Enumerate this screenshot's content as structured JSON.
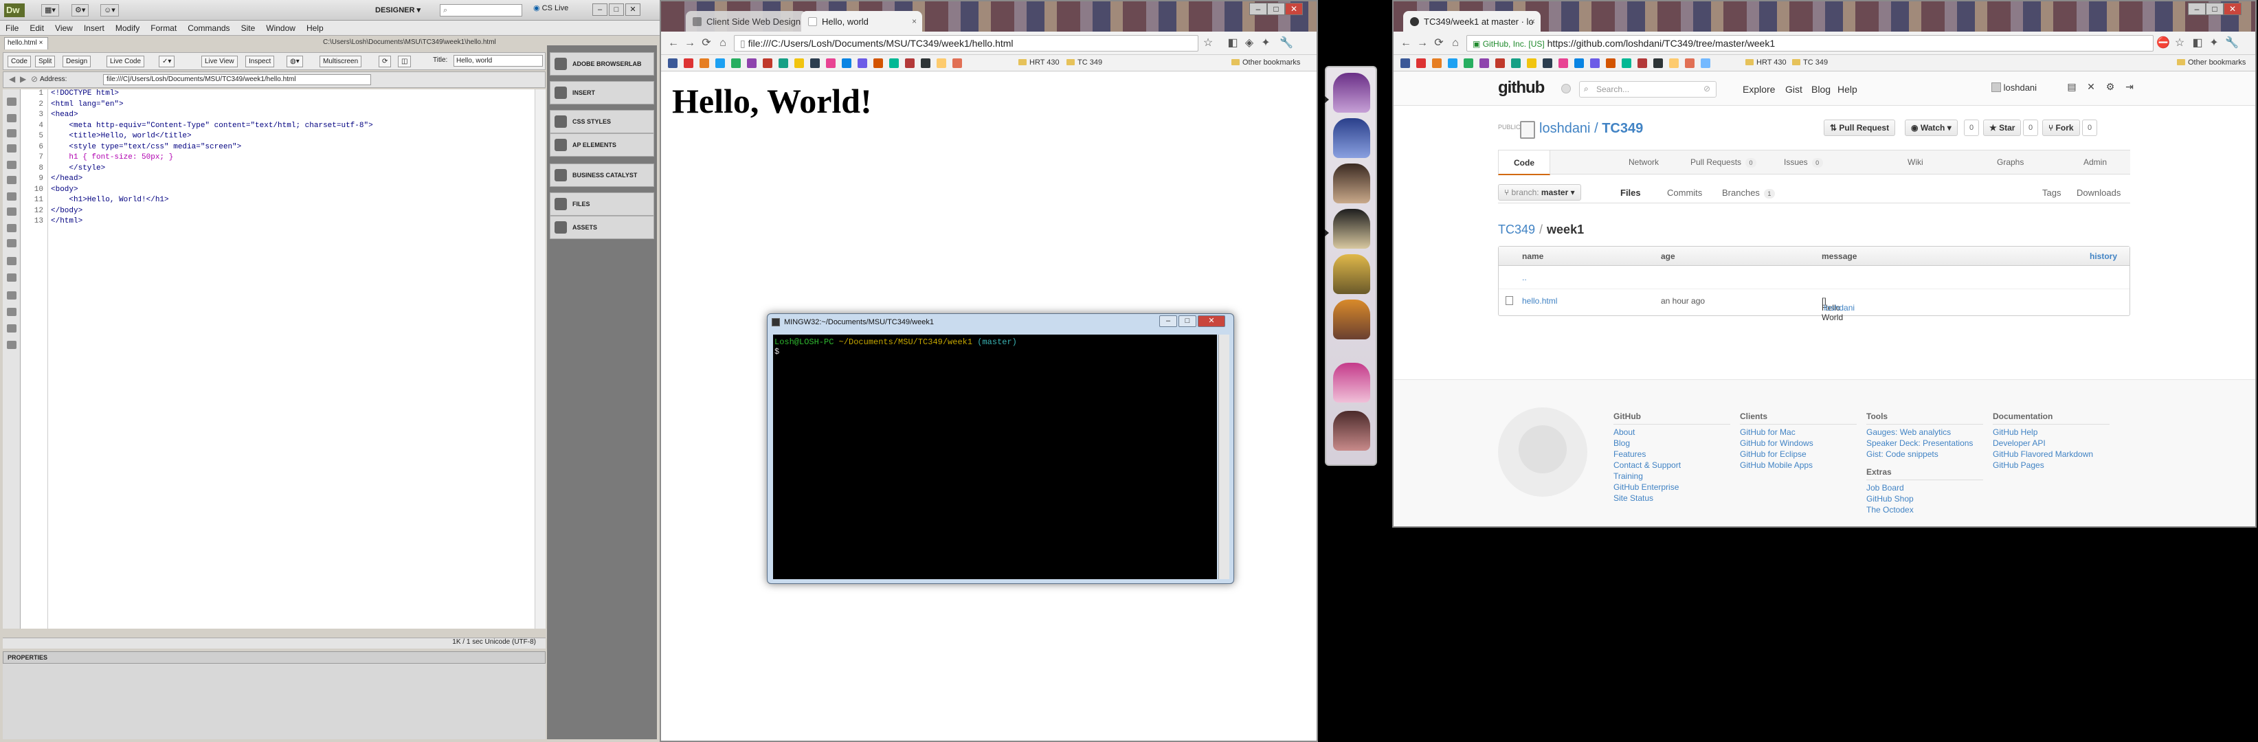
{
  "dreamweaver": {
    "logo": "Dw",
    "workspace": "DESIGNER",
    "cs_live": "CS Live",
    "menu": [
      "File",
      "Edit",
      "View",
      "Insert",
      "Modify",
      "Format",
      "Commands",
      "Site",
      "Window",
      "Help"
    ],
    "doc_tab": "hello.html",
    "file_path": "C:\\Users\\Losh\\Documents\\MSU\\TC349\\week1\\hello.html",
    "toolbar": {
      "code": "Code",
      "split": "Split",
      "design": "Design",
      "live_code": "Live Code",
      "live_view": "Live View",
      "inspect": "Inspect",
      "multiscreen": "Multiscreen",
      "title_label": "Title:",
      "title_value": "Hello, world"
    },
    "address_label": "Address:",
    "address_value": "file:///C|/Users/Losh/Documents/MSU/TC349/week1/hello.html",
    "line_numbers": [
      "1",
      "2",
      "3",
      "4",
      "5",
      "6",
      "7",
      "8",
      "9",
      "10",
      "11",
      "12",
      "13"
    ],
    "code_lines": [
      "<!DOCTYPE html>",
      "<html lang=\"en\">",
      "<head>",
      "    <meta http-equiv=\"Content-Type\" content=\"text/html; charset=utf-8\">",
      "    <title>Hello, world</title>",
      "    <style type=\"text/css\" media=\"screen\">",
      "    h1 { font-size: 50px; }",
      "    </style>",
      "</head>",
      "<body>",
      "    <h1>Hello, World!</h1>",
      "</body>",
      "</html>"
    ],
    "status_text": "1K / 1 sec  Unicode (UTF-8)",
    "properties_label": "PROPERTIES",
    "panels": [
      "ADOBE BROWSERLAB",
      "INSERT",
      "CSS STYLES",
      "AP ELEMENTS",
      "BUSINESS CATALYST",
      "FILES",
      "ASSETS"
    ]
  },
  "chrome1": {
    "tabs": [
      {
        "label": "Client Side Web Design"
      },
      {
        "label": "Hello, world"
      }
    ],
    "url": "file:///C:/Users/Losh/Documents/MSU/TC349/week1/hello.html",
    "bookmark_folders": [
      "HRT 430",
      "TC 349"
    ],
    "other_bookmarks": "Other bookmarks",
    "page_heading": "Hello, World!"
  },
  "terminal": {
    "title": "MINGW32:~/Documents/MSU/TC349/week1",
    "prompt_user": "Losh@LOSH-PC",
    "prompt_path": "~/Documents/MSU/TC349/week1",
    "prompt_branch": "(master)",
    "prompt_symbol": "$"
  },
  "chrome2": {
    "tab_label": "TC349/week1 at master · lo",
    "ev_badge": "GitHub, Inc. [US]",
    "url": "https://github.com/loshdani/TC349/tree/master/week1",
    "bookmark_folders": [
      "HRT 430",
      "TC 349"
    ],
    "other_bookmarks": "Other bookmarks"
  },
  "github": {
    "logo": "github",
    "search_placeholder": "Search...",
    "nav": [
      "Explore",
      "Gist",
      "Blog",
      "Help"
    ],
    "username": "loshdani",
    "public_label": "PUBLIC",
    "repo_owner": "loshdani",
    "repo_name": "TC349",
    "buttons": {
      "pull_request": "Pull Request",
      "watch": "Watch",
      "watch_count": "0",
      "star": "Star",
      "star_count": "0",
      "fork": "Fork",
      "fork_count": "0"
    },
    "tabs": [
      {
        "label": "Code",
        "count": ""
      },
      {
        "label": "Network",
        "count": ""
      },
      {
        "label": "Pull Requests",
        "count": "0"
      },
      {
        "label": "Issues",
        "count": "0"
      },
      {
        "label": "Wiki",
        "count": ""
      },
      {
        "label": "Graphs",
        "count": ""
      },
      {
        "label": "Admin",
        "count": ""
      }
    ],
    "branch_label": "branch:",
    "branch": "master",
    "subnav": {
      "files": "Files",
      "commits": "Commits",
      "branches": "Branches",
      "branches_count": "1",
      "tags": "Tags",
      "downloads": "Downloads"
    },
    "breadcrumb": {
      "repo": "TC349",
      "sep": "/",
      "dir": "week1"
    },
    "table": {
      "headers": {
        "name": "name",
        "age": "age",
        "message": "message",
        "history": "history"
      },
      "up": "..",
      "rows": [
        {
          "name": "hello.html",
          "age": "an hour ago",
          "message": "Hello World",
          "author": "loshdani"
        }
      ]
    },
    "footer": [
      {
        "heading": "GitHub",
        "links": [
          "About",
          "Blog",
          "Features",
          "Contact & Support",
          "Training",
          "GitHub Enterprise",
          "Site Status"
        ]
      },
      {
        "heading": "Clients",
        "links": [
          "GitHub for Mac",
          "GitHub for Windows",
          "GitHub for Eclipse",
          "GitHub Mobile Apps"
        ]
      },
      {
        "heading": "Tools",
        "links": [
          "Gauges: Web analytics",
          "Speaker Deck: Presentations",
          "Gist: Code snippets"
        ]
      },
      {
        "heading": "Extras",
        "links": [
          "Job Board",
          "GitHub Shop",
          "The Octodex"
        ]
      },
      {
        "heading": "Documentation",
        "links": [
          "GitHub Help",
          "Developer API",
          "GitHub Flavored Markdown",
          "GitHub Pages"
        ]
      }
    ]
  },
  "colors": {
    "github_link": "#4183c4",
    "github_tab_accent": "#d26911",
    "terminal_user": "#2fb82f",
    "terminal_path": "#c6a700",
    "terminal_branch": "#3ab3b3"
  }
}
